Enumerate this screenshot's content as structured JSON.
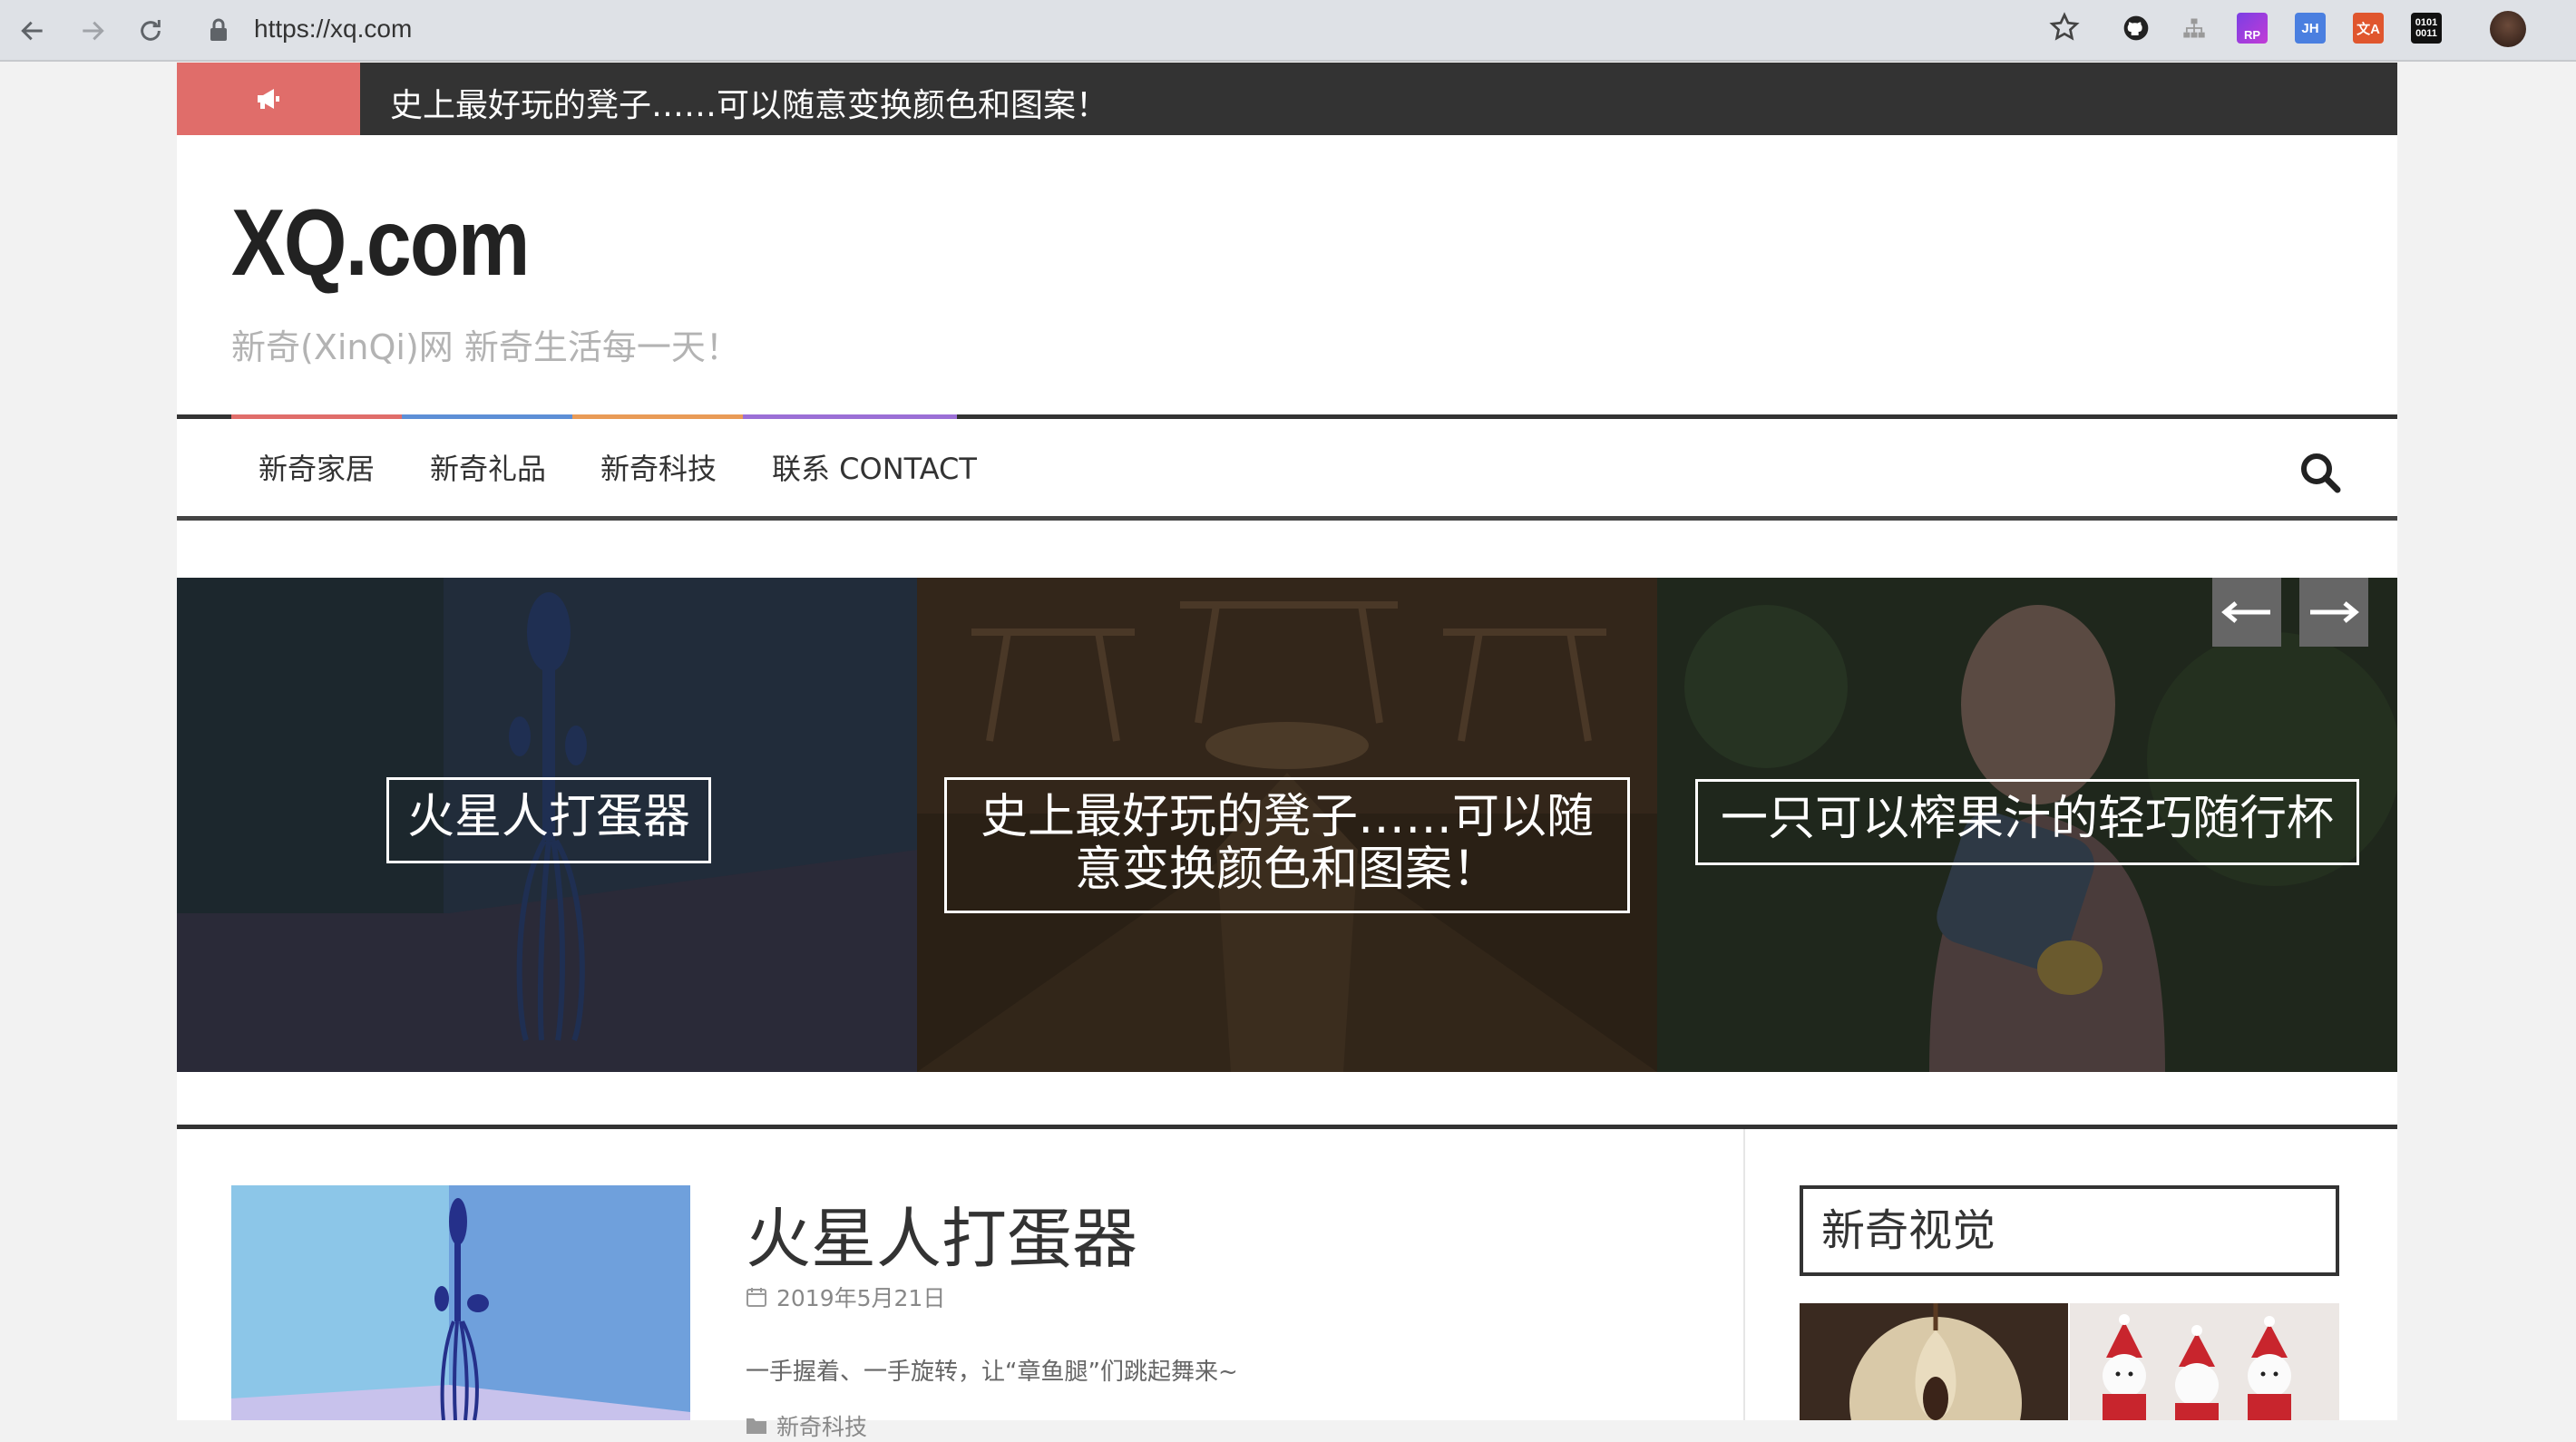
{
  "browser": {
    "url": "https://xq.com",
    "extensions": [
      {
        "name": "github-icon",
        "label": ""
      },
      {
        "name": "sitemap-icon",
        "label": ""
      },
      {
        "name": "rp-icon",
        "label": "RP"
      },
      {
        "name": "jh-icon",
        "label": "JH"
      },
      {
        "name": "translate-icon",
        "label": "文A"
      },
      {
        "name": "binary-icon",
        "label": "0101 0011"
      }
    ]
  },
  "ticker": {
    "text": "史上最好玩的凳子……可以随意变换颜色和图案！"
  },
  "site": {
    "logo": "XQ.com",
    "tagline": "新奇(XinQi)网 新奇生活每一天！"
  },
  "accent_colors": [
    "#e06d6a",
    "#5d8fd6",
    "#e99b57",
    "#9b6fd6"
  ],
  "nav": {
    "items": [
      {
        "label": "新奇家居"
      },
      {
        "label": "新奇礼品"
      },
      {
        "label": "新奇科技"
      },
      {
        "label": "联系 CONTACT"
      }
    ]
  },
  "slider": {
    "slides": [
      {
        "label": "火星人打蛋器"
      },
      {
        "label": "史上最好玩的凳子……可以随意变换颜色和图案！"
      },
      {
        "label": "一只可以榨果汁的轻巧随行杯"
      }
    ]
  },
  "post": {
    "title": "火星人打蛋器",
    "date": "2019年5月21日",
    "excerpt": "一手握着、一手旋转，让“章鱼腿”们跳起舞来~",
    "category": "新奇科技"
  },
  "sidebar": {
    "widget_title": "新奇视觉"
  }
}
